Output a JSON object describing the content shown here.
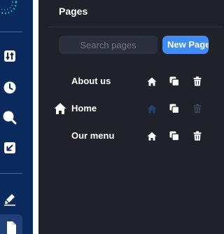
{
  "panel": {
    "title": "Pages",
    "search_placeholder": "Search pages",
    "new_page_label": "New Page"
  },
  "pages": [
    {
      "label": "About us",
      "is_home": false
    },
    {
      "label": "Home",
      "is_home": true
    },
    {
      "label": "Our menu",
      "is_home": false
    }
  ],
  "rail": {
    "icons": [
      "logo-icon",
      "sliders-icon",
      "clock-icon",
      "search-icon",
      "resize-icon",
      "brush-icon",
      "page-icon"
    ],
    "active": "page-icon"
  },
  "colors": {
    "rail_bg": "#0a2a5e",
    "panel_bg": "#1f222b",
    "accent": "#3f8cf4",
    "search_bg": "#2b303c",
    "disabled_icon": "#3b4150",
    "active_home_icon": "#21416f"
  }
}
